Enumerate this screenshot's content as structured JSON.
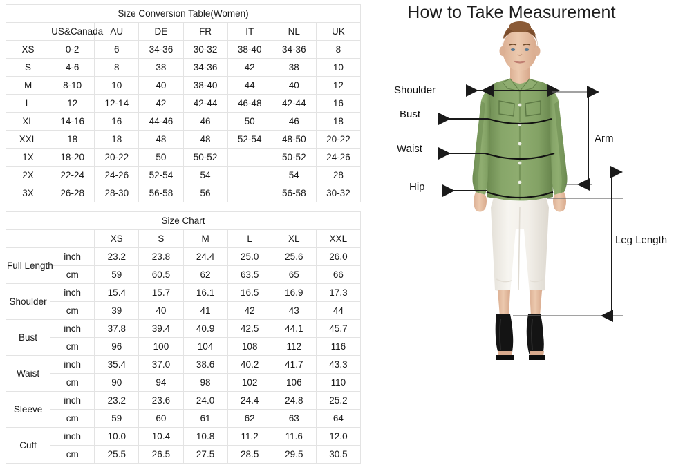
{
  "conversion_table": {
    "title": "Size Conversion Table(Women)",
    "columns": [
      "",
      "US&Canada",
      "AU",
      "DE",
      "FR",
      "IT",
      "NL",
      "UK"
    ],
    "rows": [
      {
        "size": "XS",
        "cells": [
          "0-2",
          "6",
          "34-36",
          "30-32",
          "38-40",
          "34-36",
          "8"
        ]
      },
      {
        "size": "S",
        "cells": [
          "4-6",
          "8",
          "38",
          "34-36",
          "42",
          "38",
          "10"
        ]
      },
      {
        "size": "M",
        "cells": [
          "8-10",
          "10",
          "40",
          "38-40",
          "44",
          "40",
          "12"
        ]
      },
      {
        "size": "L",
        "cells": [
          "12",
          "12-14",
          "42",
          "42-44",
          "46-48",
          "42-44",
          "16"
        ]
      },
      {
        "size": "XL",
        "cells": [
          "14-16",
          "16",
          "44-46",
          "46",
          "50",
          "46",
          "18"
        ]
      },
      {
        "size": "XXL",
        "cells": [
          "18",
          "18",
          "48",
          "48",
          "52-54",
          "48-50",
          "20-22"
        ]
      },
      {
        "size": "1X",
        "cells": [
          "18-20",
          "20-22",
          "50",
          "50-52",
          "",
          "50-52",
          "24-26"
        ]
      },
      {
        "size": "2X",
        "cells": [
          "22-24",
          "24-26",
          "52-54",
          "54",
          "",
          "54",
          "28"
        ]
      },
      {
        "size": "3X",
        "cells": [
          "26-28",
          "28-30",
          "56-58",
          "56",
          "",
          "56-58",
          "30-32"
        ]
      }
    ]
  },
  "size_chart": {
    "title": "Size Chart",
    "corner_label": "",
    "unit_label": "",
    "sizes": [
      "XS",
      "S",
      "M",
      "L",
      "XL",
      "XXL"
    ],
    "units": [
      "inch",
      "cm"
    ],
    "measurements": [
      {
        "name": "Full Length",
        "inch": [
          "23.2",
          "23.8",
          "24.4",
          "25.0",
          "25.6",
          "26.0"
        ],
        "cm": [
          "59",
          "60.5",
          "62",
          "63.5",
          "65",
          "66"
        ]
      },
      {
        "name": "Shoulder",
        "inch": [
          "15.4",
          "15.7",
          "16.1",
          "16.5",
          "16.9",
          "17.3"
        ],
        "cm": [
          "39",
          "40",
          "41",
          "42",
          "43",
          "44"
        ]
      },
      {
        "name": "Bust",
        "inch": [
          "37.8",
          "39.4",
          "40.9",
          "42.5",
          "44.1",
          "45.7"
        ],
        "cm": [
          "96",
          "100",
          "104",
          "108",
          "112",
          "116"
        ]
      },
      {
        "name": "Waist",
        "inch": [
          "35.4",
          "37.0",
          "38.6",
          "40.2",
          "41.7",
          "43.3"
        ],
        "cm": [
          "90",
          "94",
          "98",
          "102",
          "106",
          "110"
        ]
      },
      {
        "name": "Sleeve",
        "inch": [
          "23.2",
          "23.6",
          "24.0",
          "24.4",
          "24.8",
          "25.2"
        ],
        "cm": [
          "59",
          "60",
          "61",
          "62",
          "63",
          "64"
        ]
      },
      {
        "name": "Cuff",
        "inch": [
          "10.0",
          "10.4",
          "10.8",
          "11.2",
          "11.6",
          "12.0"
        ],
        "cm": [
          "25.5",
          "26.5",
          "27.5",
          "28.5",
          "29.5",
          "30.5"
        ]
      }
    ]
  },
  "figure": {
    "title": "How to Take Measurement",
    "labels": {
      "shoulder": "Shoulder",
      "bust": "Bust",
      "waist": "Waist",
      "hip": "Hip",
      "arm": "Arm",
      "leg_length": "Leg Length"
    },
    "colors": {
      "blouse": "#7d9c5f",
      "blouse_shade": "#6c8a50",
      "blouse_light": "#8fad70",
      "trousers": "#f4f2ed",
      "trousers_shade": "#e4e0d8",
      "skin": "#e8c3a8",
      "skin_shade": "#d8ad90",
      "hair": "#8a5a36",
      "shoes": "#141414",
      "arrow": "#1a1a1a",
      "guide": "#6a6a6a",
      "border": "#e3e3e3"
    }
  }
}
